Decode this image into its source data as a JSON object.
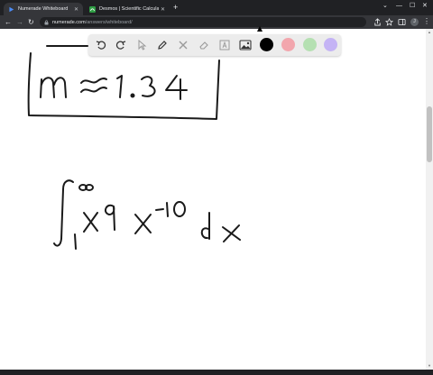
{
  "browser": {
    "tabs": [
      {
        "title": "Numerade Whiteboard",
        "favicon": "numerade-play-icon",
        "active": true
      },
      {
        "title": "Desmos | Scientific Calculator",
        "favicon": "desmos-icon",
        "active": false
      }
    ],
    "new_tab_label": "+",
    "url_host": "numerade.com",
    "url_path": "/answers/whiteboard/",
    "profile_initial": "J"
  },
  "whiteboard": {
    "toolbar_tools": [
      "undo-icon",
      "redo-icon",
      "select-pointer-icon",
      "pen-icon",
      "tools-icon",
      "eraser-icon",
      "text-tool-icon",
      "image-tool-icon"
    ],
    "colors": [
      "#000000",
      "#f2a6ad",
      "#b5e0b2",
      "#c4b3f5"
    ],
    "selected_color": "#000000"
  },
  "colors": {
    "tab_strip": "#202124",
    "toolbar": "#35363a",
    "ink": "#1a1a1a"
  }
}
